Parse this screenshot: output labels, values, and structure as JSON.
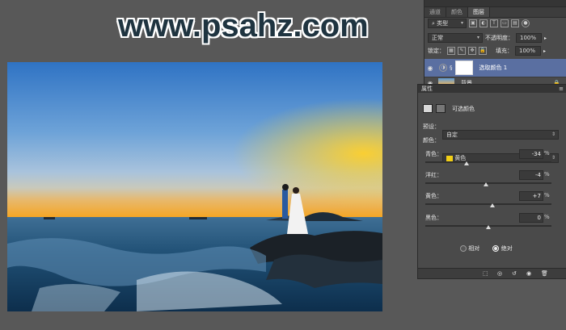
{
  "watermark": "www.psahz.com",
  "layers_panel": {
    "tabs": [
      "通道",
      "颜色",
      "图层"
    ],
    "active_tab": "图层",
    "filter_kind": "类型",
    "blend_mode": "正常",
    "opacity_label": "不透明度：",
    "opacity_value": "100%",
    "lock_label": "锁定：",
    "fill_label": "填充：",
    "fill_value": "100%",
    "layers": [
      {
        "name": "选取颜色 1",
        "selected": true
      },
      {
        "name": "背景",
        "selected": false
      }
    ]
  },
  "properties_panel": {
    "title": "属性",
    "adjustment_name": "可选颜色",
    "preset_label": "预设：",
    "preset_value": "自定",
    "colors_label": "颜色：",
    "colors_value": "黄色",
    "swatch_color": "#f2cf16",
    "sliders": [
      {
        "label": "青色：",
        "value": "-34",
        "unit": "%",
        "level": -34
      },
      {
        "label": "洋红：",
        "value": "-4",
        "unit": "%",
        "level": -4
      },
      {
        "label": "黄色：",
        "value": "+7",
        "unit": "%",
        "level": 7
      },
      {
        "label": "黑色：",
        "value": "0",
        "unit": "%",
        "level": 0
      }
    ],
    "method_options": [
      {
        "label": "相对",
        "selected": false
      },
      {
        "label": "绝对",
        "selected": true
      }
    ]
  }
}
